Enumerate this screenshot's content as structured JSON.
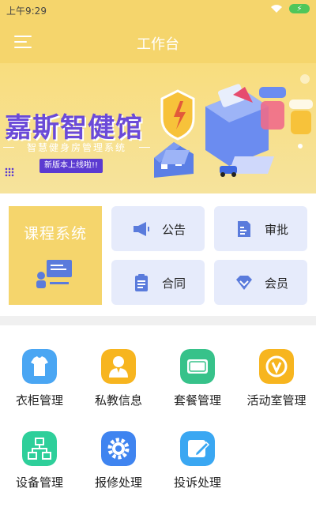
{
  "status_bar": {
    "time": "上午9:29",
    "battery_icon": "battery-charging-icon",
    "wifi_icon": "wifi-icon"
  },
  "header": {
    "title": "工作台",
    "menu_icon": "menu-icon"
  },
  "banner": {
    "title": "嘉斯智健馆",
    "subtitle": "智慧健身房管理系统",
    "badge": "新版本上线啦!!"
  },
  "quick_access": {
    "course": {
      "label": "课程系统",
      "icon": "presentation-board-icon"
    },
    "buttons": [
      {
        "label": "公告",
        "icon": "megaphone-icon"
      },
      {
        "label": "审批",
        "icon": "document-approval-icon"
      },
      {
        "label": "合同",
        "icon": "clipboard-icon"
      },
      {
        "label": "会员",
        "icon": "diamond-icon"
      }
    ]
  },
  "features": [
    {
      "label": "衣柜管理",
      "icon": "clothes-icon",
      "color": "#4aa6f3"
    },
    {
      "label": "私教信息",
      "icon": "coach-icon",
      "color": "#f7b51f"
    },
    {
      "label": "套餐管理",
      "icon": "package-icon",
      "color": "#37c28a"
    },
    {
      "label": "活动室管理",
      "icon": "badge-v-icon",
      "color": "#f7b51f"
    },
    {
      "label": "设备管理",
      "icon": "network-icon",
      "color": "#2ecf9a"
    },
    {
      "label": "报修处理",
      "icon": "gear-icon",
      "color": "#3f84f0"
    },
    {
      "label": "投诉处理",
      "icon": "edit-icon",
      "color": "#3aa7f2"
    }
  ],
  "colors": {
    "primary": "#f5d56c",
    "tile": "#e6ebfb",
    "icon_blue": "#5a7bdc"
  }
}
